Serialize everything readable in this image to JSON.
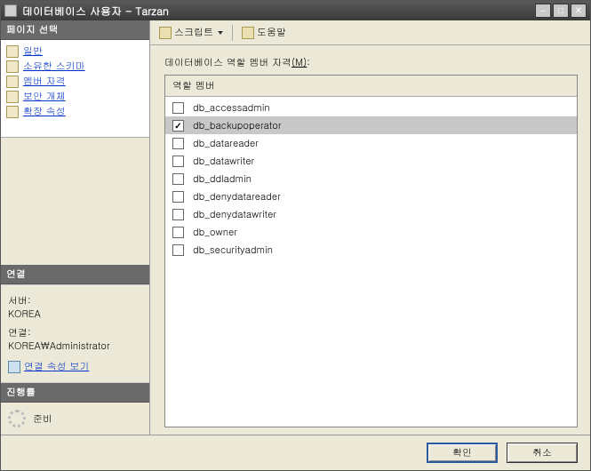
{
  "window": {
    "title": "데이터베이스 사용자 - Tarzan"
  },
  "toolbar": {
    "script_label": "스크립트",
    "help_label": "도움말"
  },
  "sidebar": {
    "page_select_header": "페이지 선택",
    "items": [
      {
        "label": "일반"
      },
      {
        "label": "소유한 스키마"
      },
      {
        "label": "멤버 자격"
      },
      {
        "label": "보안 개체"
      },
      {
        "label": "확장 속성"
      }
    ],
    "connection_header": "연결",
    "server_label": "서버:",
    "server_value": "KOREA",
    "conn_label": "연결:",
    "conn_value": "KOREA\\Administrator",
    "view_conn_label": "연결 속성 보기",
    "progress_header": "진행률",
    "progress_status": "준비"
  },
  "main": {
    "role_membership_label": "데이터베이스 역할 멤버 자격",
    "role_membership_accel": "(M)",
    "column_header": "역할 멤버",
    "roles": [
      {
        "name": "db_accessadmin",
        "checked": false,
        "selected": false
      },
      {
        "name": "db_backupoperator",
        "checked": true,
        "selected": true
      },
      {
        "name": "db_datareader",
        "checked": false,
        "selected": false
      },
      {
        "name": "db_datawriter",
        "checked": false,
        "selected": false
      },
      {
        "name": "db_ddladmin",
        "checked": false,
        "selected": false
      },
      {
        "name": "db_denydatareader",
        "checked": false,
        "selected": false
      },
      {
        "name": "db_denydatawriter",
        "checked": false,
        "selected": false
      },
      {
        "name": "db_owner",
        "checked": false,
        "selected": false
      },
      {
        "name": "db_securityadmin",
        "checked": false,
        "selected": false
      }
    ]
  },
  "footer": {
    "ok_label": "확인",
    "cancel_label": "취소"
  }
}
